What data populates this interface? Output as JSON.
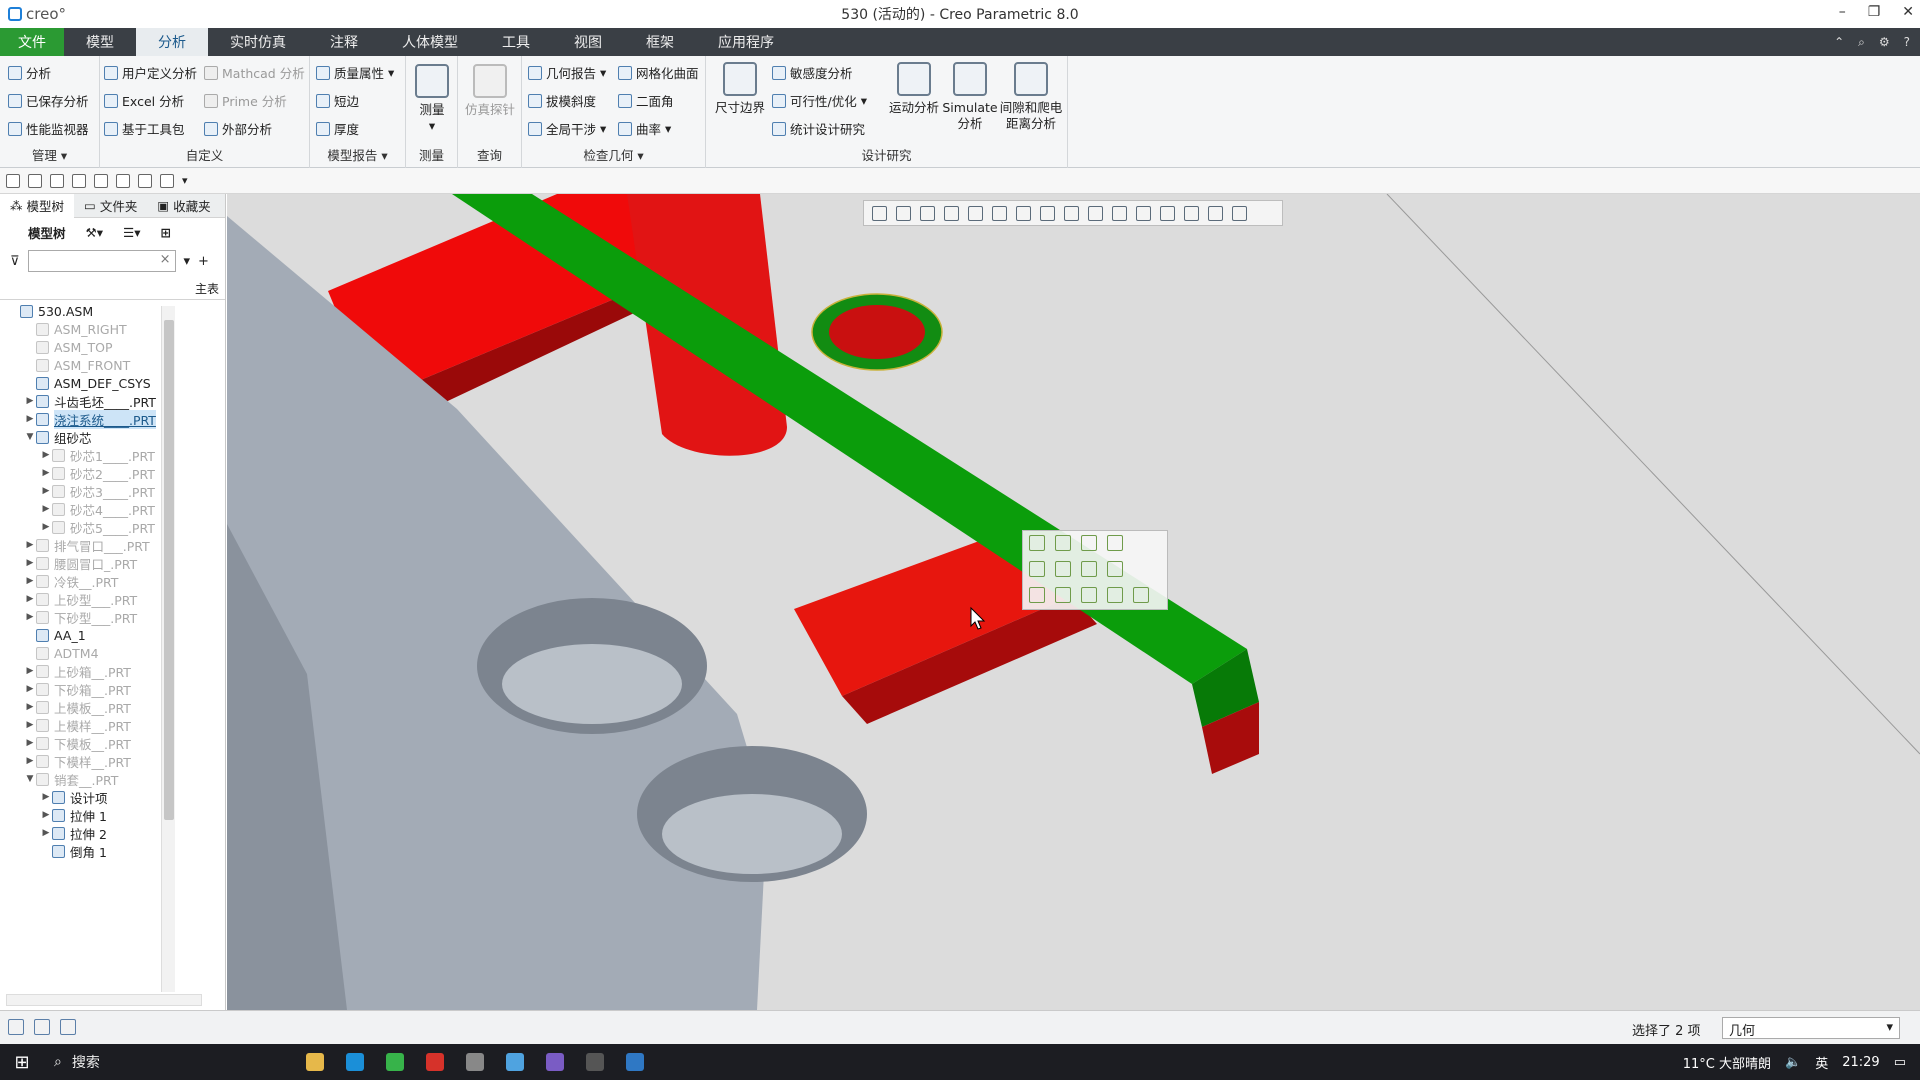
{
  "window": {
    "title": "530 (活动的) - Creo Parametric 8.0",
    "brand": "creo°"
  },
  "menu_tabs": [
    "模型",
    "分析",
    "实时仿真",
    "注释",
    "人体模型",
    "工具",
    "视图",
    "框架",
    "应用程序"
  ],
  "file_tab": "文件",
  "ribbon": {
    "manage": {
      "items": [
        "分析",
        "已保存分析",
        "性能监视器"
      ],
      "title": "管理"
    },
    "custom": {
      "items": [
        "用户定义分析",
        "Excel 分析",
        "基于工具包",
        "Mathcad 分析",
        "Prime 分析",
        "外部分析"
      ],
      "title": "自定义"
    },
    "model_report": {
      "items": [
        "质量属性",
        "短边",
        "厚度"
      ],
      "title": "模型报告"
    },
    "measure": {
      "label": "测量",
      "title": "测量"
    },
    "query": {
      "label": "仿真探针",
      "title": "查询"
    },
    "inspect": {
      "items": [
        "几何报告",
        "网格化曲面",
        "拔模斜度",
        "二面角",
        "全局干涉",
        "曲率"
      ],
      "title": "检查几何"
    },
    "design_study": {
      "dim_boundary": "尺寸边界",
      "items": [
        "敏感度分析",
        "可行性/优化",
        "统计设计研究"
      ],
      "motion": "运动分析",
      "simulate": "Simulate\n分析",
      "clearance": "间隙和爬电\n距离分析",
      "title": "设计研究"
    }
  },
  "panel": {
    "tabs": [
      "模型树",
      "文件夹",
      "收藏夹"
    ],
    "tool_label": "模型树",
    "col_header": "主表",
    "tree": [
      {
        "label": "530.ASM",
        "level": 0,
        "tw": "",
        "sup": false
      },
      {
        "label": "ASM_RIGHT",
        "level": 1,
        "tw": "",
        "sup": true
      },
      {
        "label": "ASM_TOP",
        "level": 1,
        "tw": "",
        "sup": true
      },
      {
        "label": "ASM_FRONT",
        "level": 1,
        "tw": "",
        "sup": true
      },
      {
        "label": "ASM_DEF_CSYS",
        "level": 1,
        "tw": "",
        "sup": false
      },
      {
        "label": "斗齿毛坯____.PRT",
        "level": 1,
        "tw": "▶",
        "sup": false
      },
      {
        "label": "浇注系统____.PRT",
        "level": 1,
        "tw": "▶",
        "sup": false,
        "sel": true
      },
      {
        "label": "组砂芯",
        "level": 1,
        "tw": "▼",
        "sup": false
      },
      {
        "label": "砂芯1____.PRT",
        "level": 2,
        "tw": "▶",
        "sup": true
      },
      {
        "label": "砂芯2____.PRT",
        "level": 2,
        "tw": "▶",
        "sup": true
      },
      {
        "label": "砂芯3____.PRT",
        "level": 2,
        "tw": "▶",
        "sup": true
      },
      {
        "label": "砂芯4____.PRT",
        "level": 2,
        "tw": "▶",
        "sup": true
      },
      {
        "label": "砂芯5____.PRT",
        "level": 2,
        "tw": "▶",
        "sup": true
      },
      {
        "label": "排气冒口___.PRT",
        "level": 1,
        "tw": "▶",
        "sup": true
      },
      {
        "label": "腰圆冒口_.PRT",
        "level": 1,
        "tw": "▶",
        "sup": true
      },
      {
        "label": "冷铁__.PRT",
        "level": 1,
        "tw": "▶",
        "sup": true
      },
      {
        "label": "上砂型___.PRT",
        "level": 1,
        "tw": "▶",
        "sup": true
      },
      {
        "label": "下砂型___.PRT",
        "level": 1,
        "tw": "▶",
        "sup": true
      },
      {
        "label": "AA_1",
        "level": 1,
        "tw": "",
        "sup": false
      },
      {
        "label": "ADTM4",
        "level": 1,
        "tw": "",
        "sup": true
      },
      {
        "label": "上砂箱__.PRT",
        "level": 1,
        "tw": "▶",
        "sup": true
      },
      {
        "label": "下砂箱__.PRT",
        "level": 1,
        "tw": "▶",
        "sup": true
      },
      {
        "label": "上模板__.PRT",
        "level": 1,
        "tw": "▶",
        "sup": true
      },
      {
        "label": "上模样__.PRT",
        "level": 1,
        "tw": "▶",
        "sup": true
      },
      {
        "label": "下模板__.PRT",
        "level": 1,
        "tw": "▶",
        "sup": true
      },
      {
        "label": "下模样__.PRT",
        "level": 1,
        "tw": "▶",
        "sup": true
      },
      {
        "label": "销套__.PRT",
        "level": 1,
        "tw": "▼",
        "sup": true
      },
      {
        "label": "设计项",
        "level": 2,
        "tw": "▶",
        "sup": false
      },
      {
        "label": "拉伸 1",
        "level": 2,
        "tw": "▶",
        "sup": false
      },
      {
        "label": "拉伸 2",
        "level": 2,
        "tw": "▶",
        "sup": false
      },
      {
        "label": "倒角 1",
        "level": 2,
        "tw": "",
        "sup": false
      }
    ]
  },
  "status": {
    "selection": "选择了 2 项",
    "filter": "几何"
  },
  "taskbar": {
    "search": "搜索",
    "weather": "11°C 大部晴朗",
    "ime": "英",
    "time": "21:29"
  },
  "colors": {
    "accent_green": "#2b9a33",
    "runner_green": "#0a9b0a",
    "runner_red": "#e01010",
    "part_gray": "#a0a8b3"
  }
}
